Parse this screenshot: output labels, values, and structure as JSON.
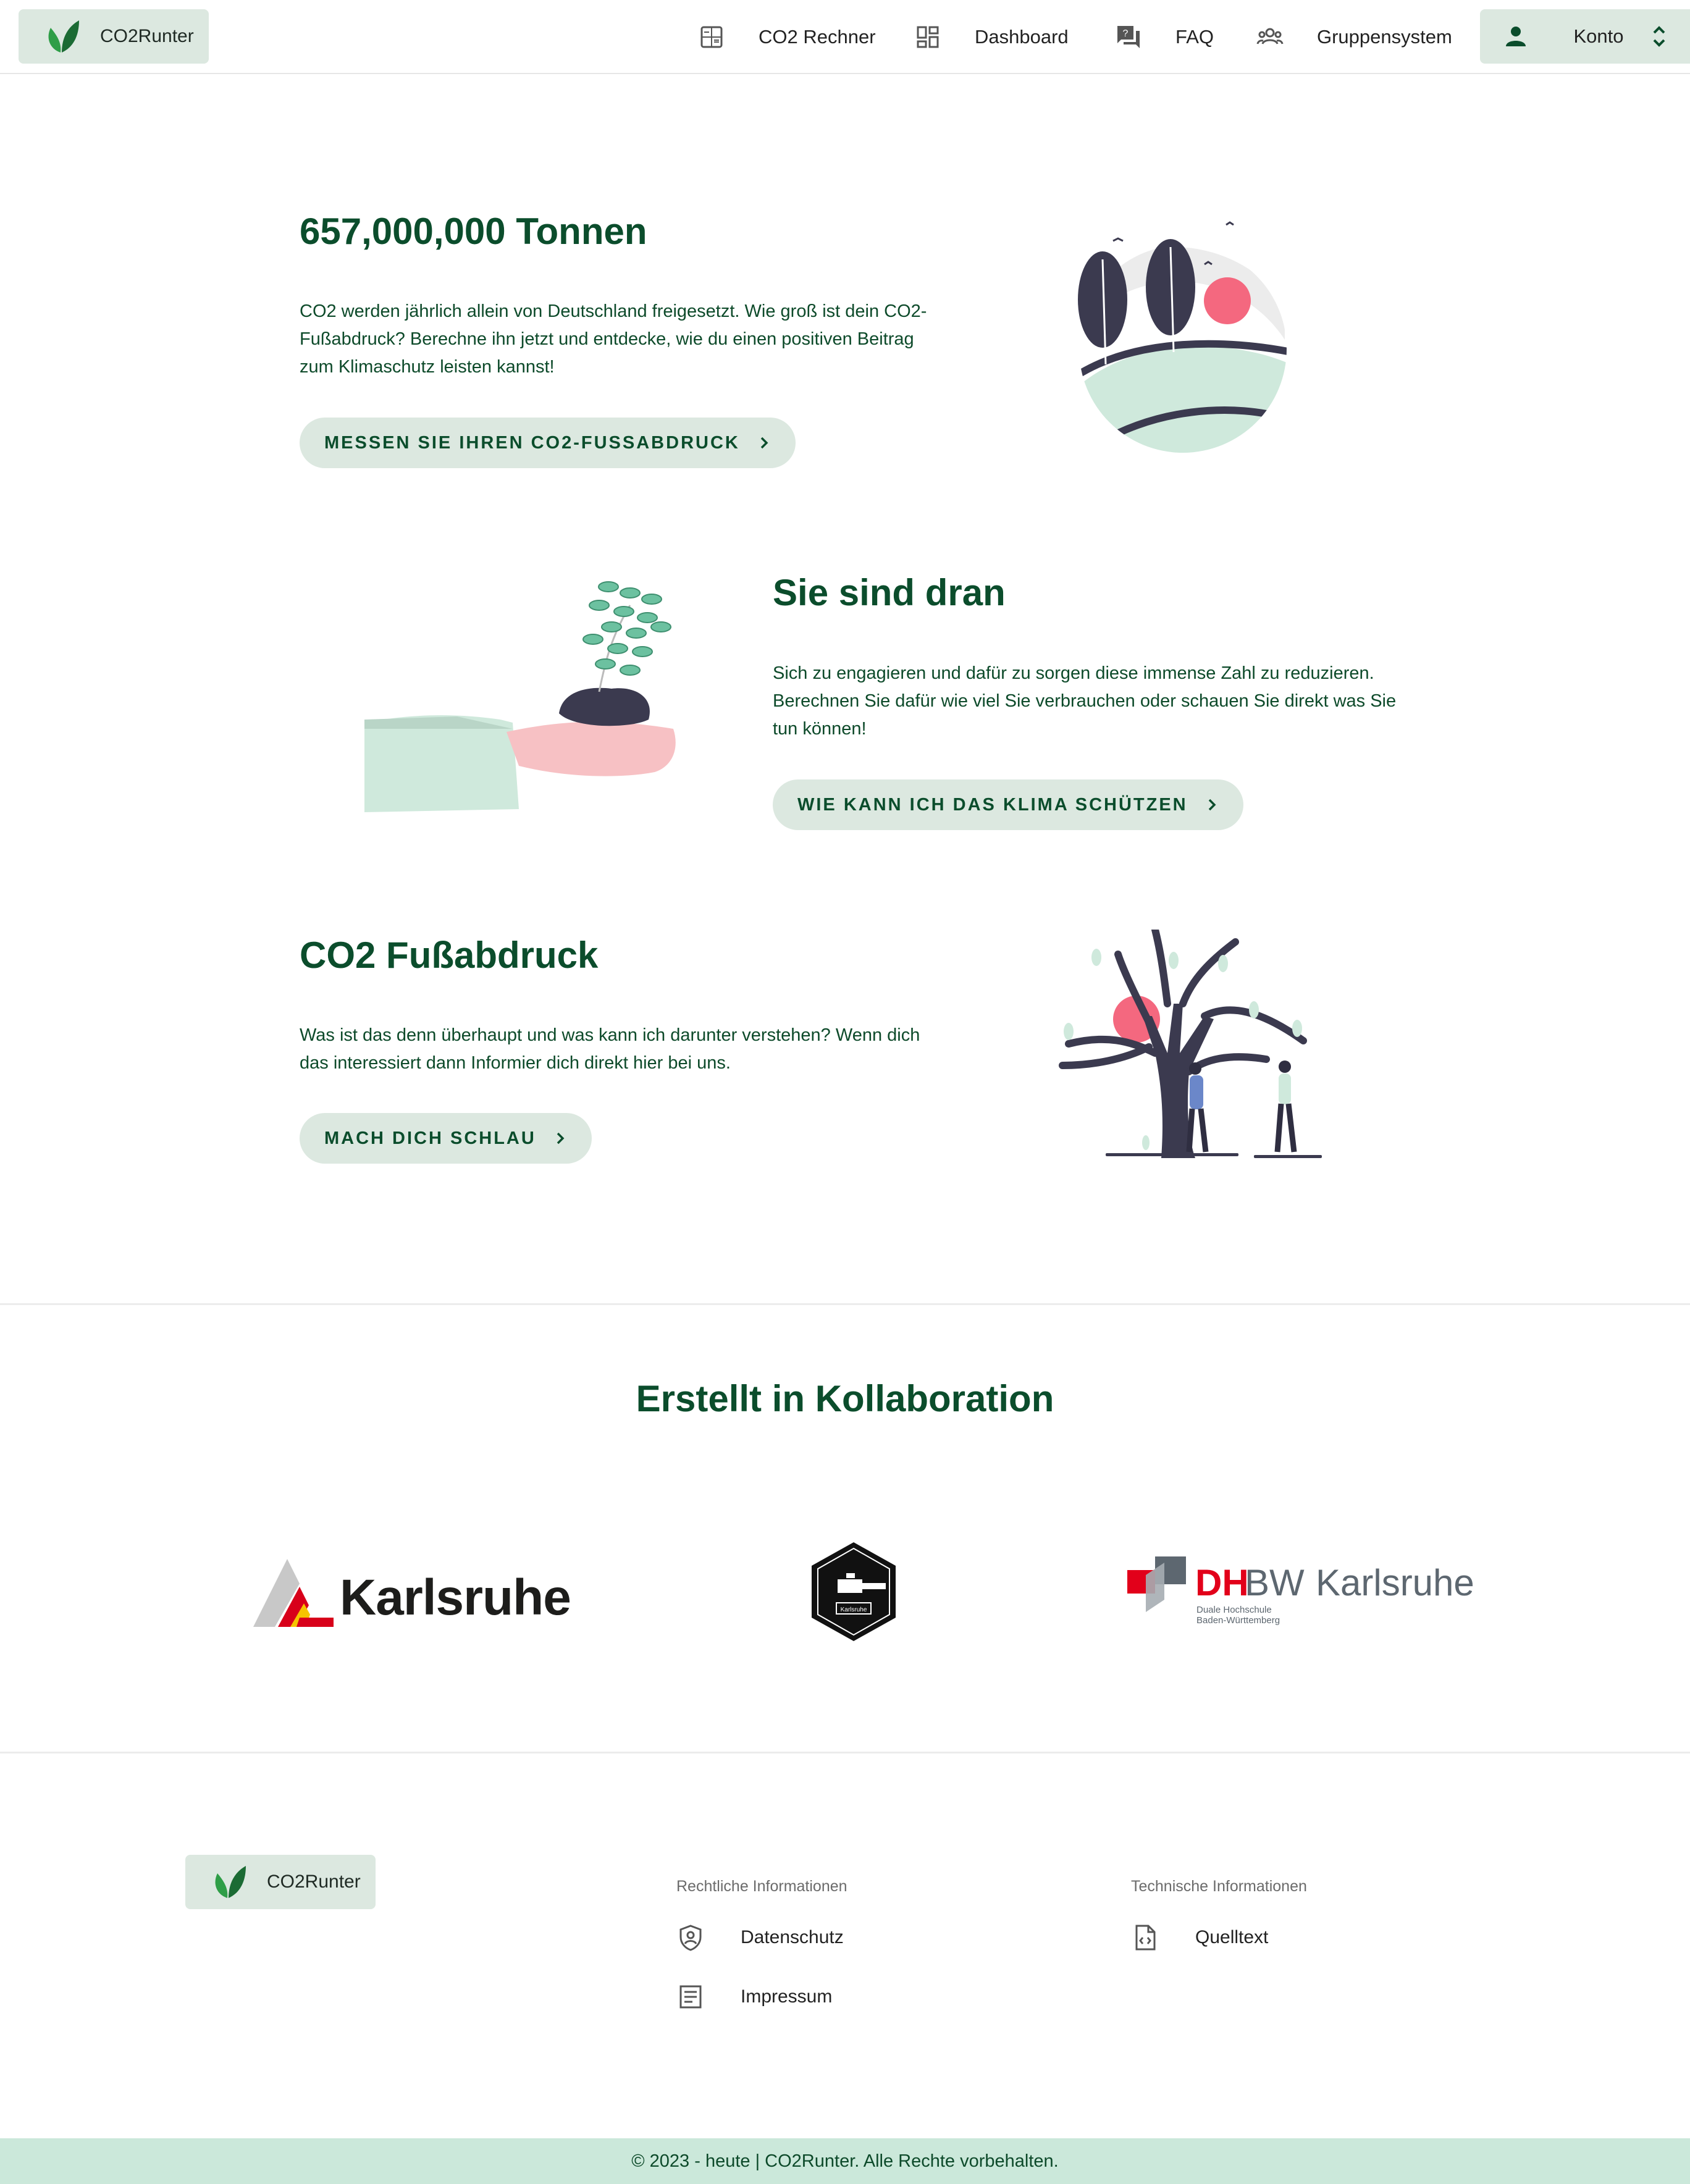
{
  "nav": {
    "brand": "CO2Runter",
    "links": [
      {
        "label": "CO2 Rechner",
        "icon": "calculator-icon"
      },
      {
        "label": "Dashboard",
        "icon": "dashboard-icon"
      },
      {
        "label": "FAQ",
        "icon": "faq-icon"
      },
      {
        "label": "Gruppensystem",
        "icon": "group-icon"
      }
    ],
    "account": {
      "label": "Konto",
      "icon": "person-icon"
    }
  },
  "sections": [
    {
      "title": "657,000,000 Tonnen",
      "text": "CO2 werden jährlich allein von Deutschland freigesetzt. Wie groß ist dein CO2-Fußabdruck? Berechne ihn jetzt und entdecke, wie du einen positiven Beitrag zum Klimaschutz leisten kannst!",
      "button": "MESSEN SIE IHREN CO2-FUSSABDRUCK"
    },
    {
      "title": "Sie sind dran",
      "text": "Sich zu engagieren und dafür zu sorgen diese immense Zahl zu reduzieren. Berechnen Sie dafür wie viel Sie verbrauchen oder schauen Sie direkt was Sie tun können!",
      "button": "WIE KANN ICH DAS KLIMA SCHÜTZEN"
    },
    {
      "title": "CO2 Fußabdruck",
      "text": "Was ist das denn überhaupt und was kann ich darunter verstehen? Wenn dich das interessiert dann Informier dich direkt hier bei uns.",
      "button": "MACH DICH SCHLAU"
    }
  ],
  "collaboration": {
    "title": "Erstellt in Kollaboration",
    "partners": [
      {
        "name": "Karlsruhe"
      },
      {
        "name": "Karlsruhe"
      },
      {
        "name": "DHBW Karlsruhe",
        "abbr": "DHBW",
        "city": "Karlsruhe",
        "sub1": "Duale Hochschule",
        "sub2": "Baden-Württemberg"
      }
    ]
  },
  "footer": {
    "brand": "CO2Runter",
    "legal_heading": "Rechtliche Informationen",
    "legal_links": [
      {
        "label": "Datenschutz",
        "icon": "shield-person-icon"
      },
      {
        "label": "Impressum",
        "icon": "document-icon"
      }
    ],
    "tech_heading": "Technische Informationen",
    "tech_links": [
      {
        "label": "Quelltext",
        "icon": "code-file-icon"
      }
    ],
    "copyright": "© 2023 - heute | CO2Runter. Alle Rechte vorbehalten."
  },
  "colors": {
    "primary": "#0b4d2c",
    "chip": "#dce8e0",
    "footer_bar": "#cbe8da",
    "accent_pink": "#f4687f",
    "mint": "#cfe9dc",
    "dark": "#3b3a4f"
  }
}
